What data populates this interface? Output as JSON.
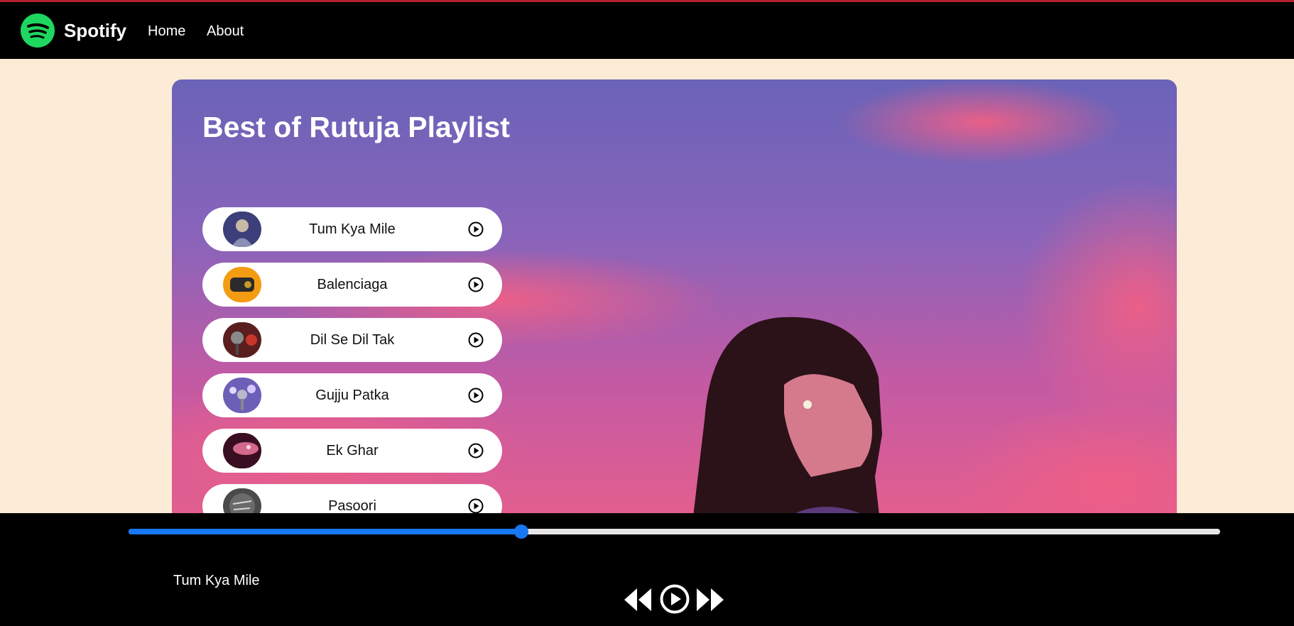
{
  "app": {
    "brand": "Spotify",
    "logo_icon": "spotify-logo-icon",
    "accent_color": "#1ed760"
  },
  "nav": {
    "links": [
      "Home",
      "About"
    ]
  },
  "playlist": {
    "title": "Best of Rutuja Playlist",
    "songs": [
      {
        "name": "Tum Kya Mile",
        "icon": "play-circle-icon"
      },
      {
        "name": "Balenciaga",
        "icon": "play-circle-icon"
      },
      {
        "name": "Dil Se Dil Tak",
        "icon": "play-circle-icon"
      },
      {
        "name": "Gujju Patka",
        "icon": "play-circle-icon"
      },
      {
        "name": "Ek Ghar",
        "icon": "play-circle-icon"
      },
      {
        "name": "Pasoori",
        "icon": "play-circle-icon"
      }
    ]
  },
  "player": {
    "now_playing": "Tum Kya Mile",
    "progress_percent": 36,
    "progress_color": "#1877f2",
    "controls": [
      "backward-icon",
      "play-circle-icon",
      "forward-icon"
    ]
  }
}
